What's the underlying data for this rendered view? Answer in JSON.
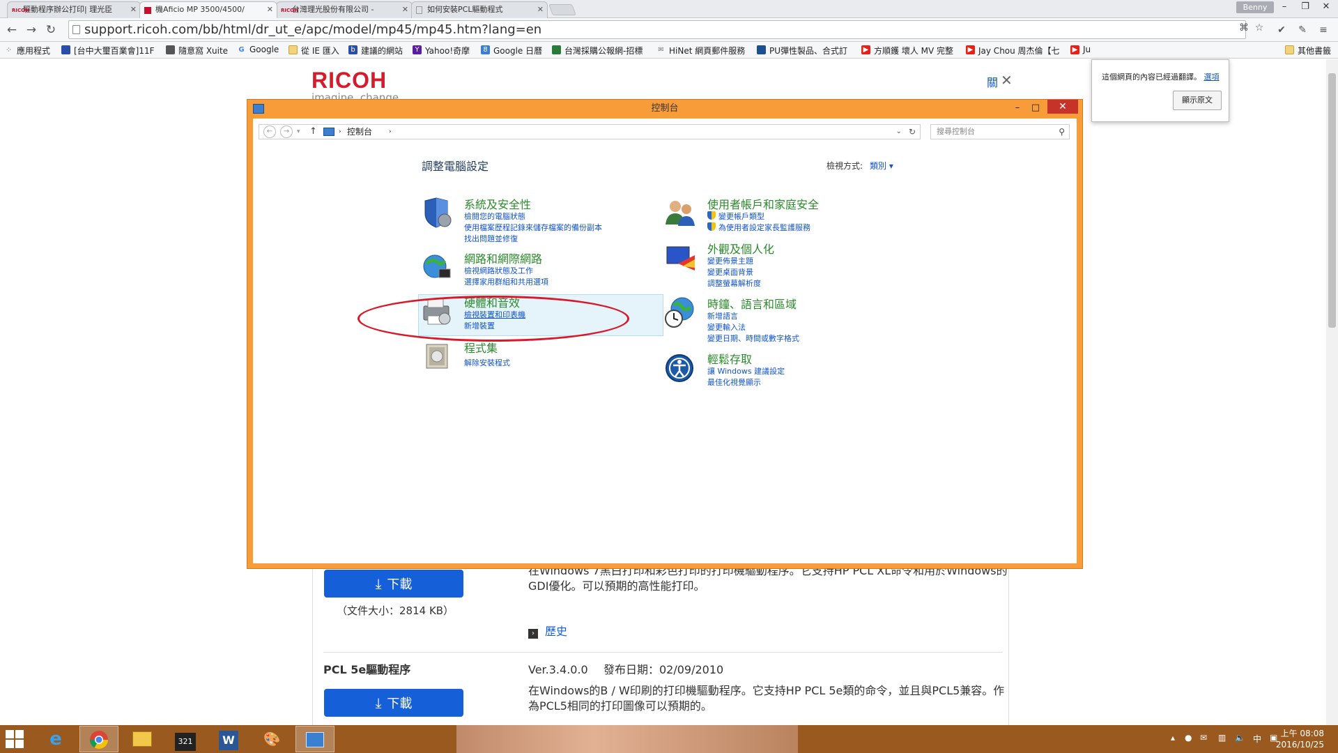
{
  "browser": {
    "tabs": [
      {
        "title": "驅動程序辦公打印| 理光臣"
      },
      {
        "title": "機Aficio MP 3500/4500/"
      },
      {
        "title": "台灣理光股份有限公司 - "
      },
      {
        "title": "如何安裝PCL驅動程式"
      }
    ],
    "user": "Benny",
    "url": "support.ricoh.com/bb/html/dr_ut_e/apc/model/mp45/mp45.htm?lang=en",
    "bookmarks": [
      "應用程式",
      "[台中大璽百業會]11F",
      "隨意窩 Xuite",
      "Google",
      "從 IE 匯入",
      "建議的網站",
      "Yahoo!奇摩",
      "Google 日曆",
      "台灣採購公報網-招標",
      "HiNet 網頁郵件服務",
      "PU彈性製品、合式訂",
      "方順鑊 壞人 MV 完整",
      "Jay Chou 周杰倫【七",
      "Ju"
    ],
    "other_bookmarks": "其他書籤"
  },
  "translate_popup": {
    "message": "這個網頁的內容已經過翻譯。",
    "options_link": "選項",
    "show_original": "顯示原文"
  },
  "page": {
    "logo": "RICOH",
    "tagline": "imagine. change.",
    "about_link": "關",
    "driver1": {
      "download": "下載",
      "filesize": "（文件大小：2814 KB）",
      "desc_line1": "在Windows 7黑白打印和彩色打印的打印機驅動程序。它支持HP PCL XL命令和用於Windows的",
      "desc_line2": "GDI優化。可以預期的高性能打印。",
      "history": "歷史"
    },
    "driver2": {
      "name": "PCL 5e驅動程序",
      "version": "Ver.3.4.0.0",
      "date": "發布日期：02/09/2010",
      "download": "下載",
      "desc_line1": "在Windows的B / W印刷的打印機驅動程序。它支持HP PCL 5e類的命令，並且與PCL5兼容。作",
      "desc_line2": "為PCL5相同的打印圖像可以預期的。"
    }
  },
  "control_panel": {
    "title": "控制台",
    "breadcrumb": "控制台",
    "search_placeholder": "搜尋控制台",
    "heading": "調整電腦設定",
    "view_by_label": "檢視方式:",
    "view_by_value": "類別",
    "categories": {
      "system": {
        "title": "系統及安全性",
        "links": [
          "檢閱您的電腦狀態",
          "使用檔案歷程記錄來儲存檔案的備份副本",
          "找出問題並修復"
        ]
      },
      "network": {
        "title": "網路和網際網路",
        "links": [
          "檢視網路狀態及工作",
          "選擇家用群組和共用選項"
        ]
      },
      "hardware": {
        "title": "硬體和音效",
        "links": [
          "檢視裝置和印表機",
          "新增裝置"
        ]
      },
      "programs": {
        "title": "程式集",
        "links": [
          "解除安裝程式"
        ]
      },
      "users": {
        "title": "使用者帳戶和家庭安全",
        "links": [
          "變更帳戶類型",
          "為使用者設定家長監護服務"
        ]
      },
      "appearance": {
        "title": "外觀及個人化",
        "links": [
          "變更佈景主題",
          "變更桌面背景",
          "調整螢幕解析度"
        ]
      },
      "clock": {
        "title": "時鐘、語言和區域",
        "links": [
          "新增語言",
          "變更輸入法",
          "變更日期、時間或數字格式"
        ]
      },
      "ease": {
        "title": "輕鬆存取",
        "links": [
          "讓 Windows 建議設定",
          "最佳化視覺顯示"
        ]
      }
    }
  },
  "taskbar": {
    "ime": "中",
    "time": "上午 08:08",
    "date": "2016/10/25"
  },
  "colors": {
    "accent": "#f89c3a",
    "ricoh_red": "#d41c2c",
    "link": "#1155cc",
    "category_green": "#2b8a2b",
    "download_blue": "#1560d8",
    "annotation_red": "#d9182a"
  }
}
